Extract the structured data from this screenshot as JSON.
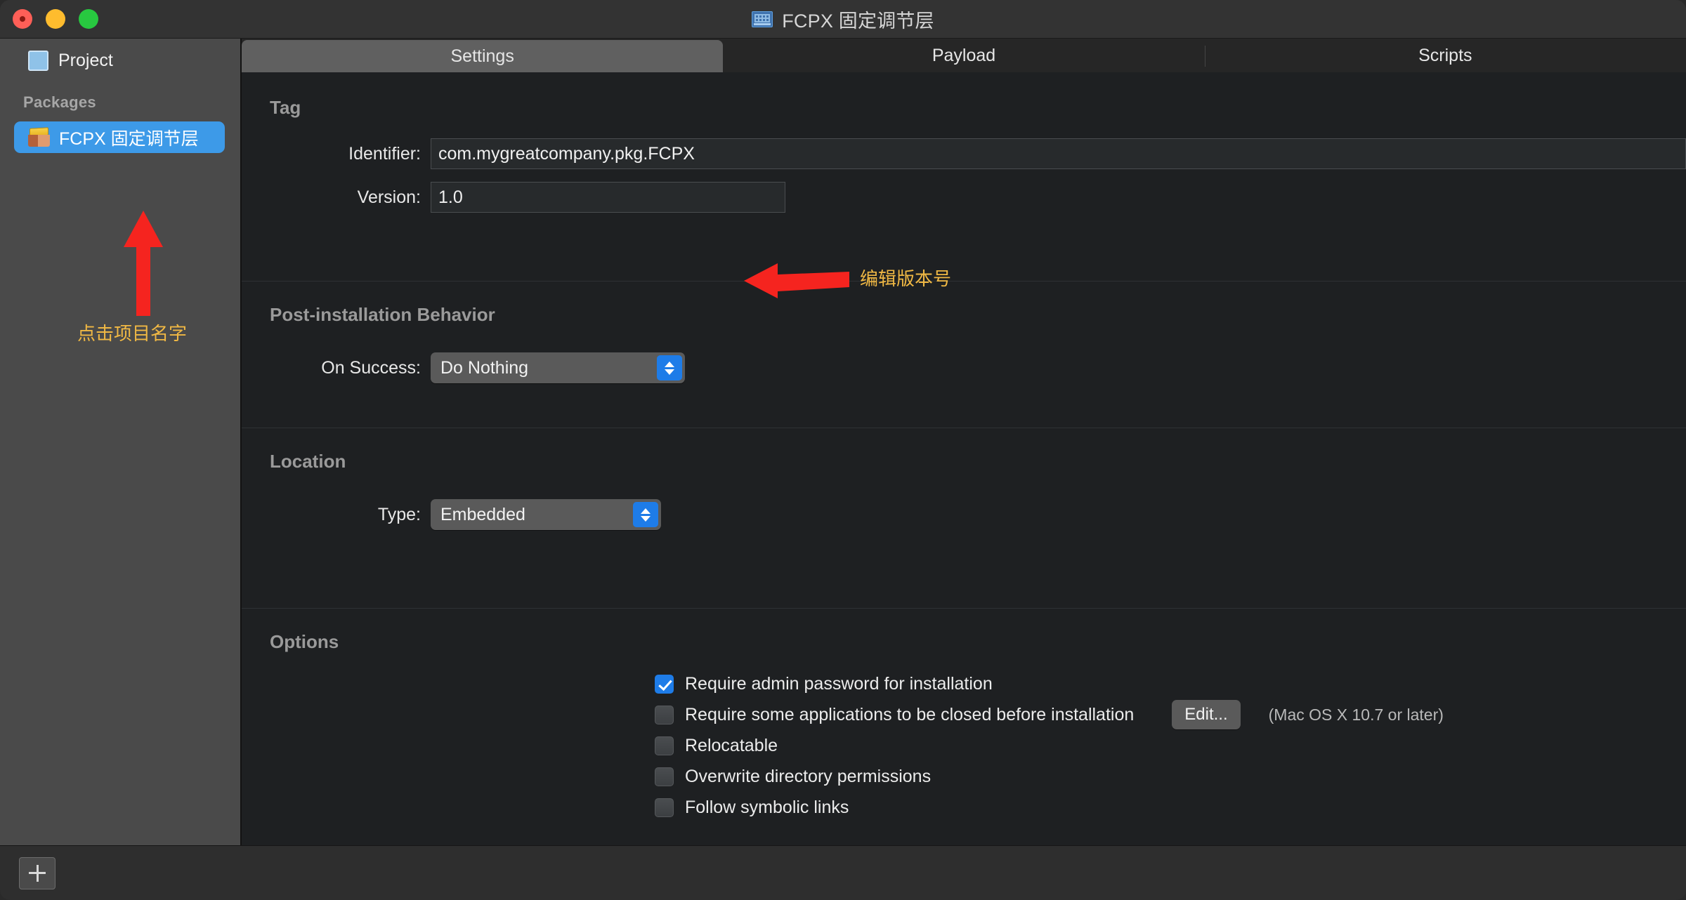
{
  "window": {
    "title": "FCPX 固定调节层",
    "title_icon": "package-window-icon",
    "traffic_lights": {
      "close": "close",
      "minimize": "minimize",
      "maximize": "maximize"
    }
  },
  "sidebar": {
    "project": {
      "label": "Project",
      "icon": "project-square-icon"
    },
    "section_header": "Packages",
    "packages": [
      {
        "label": "FCPX 固定调节层",
        "icon": "package-box-icon",
        "selected": true
      }
    ],
    "annotation": {
      "arrow": "red-up-arrow",
      "text": "点击项目名字",
      "color": "#f0b844"
    },
    "add_button": "+"
  },
  "tabs": [
    {
      "label": "Settings",
      "active": true
    },
    {
      "label": "Payload",
      "active": false
    },
    {
      "label": "Scripts",
      "active": false
    }
  ],
  "settings": {
    "tag": {
      "title": "Tag",
      "identifier": {
        "label": "Identifier:",
        "value": "com.mygreatcompany.pkg.FCPX"
      },
      "version": {
        "label": "Version:",
        "value": "1.0"
      },
      "annotation": {
        "arrow": "red-left-arrow",
        "text": "编辑版本号",
        "color": "#f0b844"
      }
    },
    "post_install": {
      "title": "Post-installation Behavior",
      "on_success": {
        "label": "On Success:",
        "value": "Do Nothing"
      }
    },
    "location": {
      "title": "Location",
      "type": {
        "label": "Type:",
        "value": "Embedded"
      }
    },
    "options": {
      "title": "Options",
      "items": [
        {
          "label": "Require admin password for installation",
          "checked": true
        },
        {
          "label": "Require some applications to be closed before installation",
          "checked": false,
          "button": "Edit...",
          "note": "(Mac OS X 10.7 or later)"
        },
        {
          "label": "Relocatable",
          "checked": false
        },
        {
          "label": "Overwrite directory permissions",
          "checked": false
        },
        {
          "label": "Follow symbolic links",
          "checked": false
        }
      ]
    }
  },
  "colors": {
    "accent_blue": "#1e7ce8",
    "selection_blue": "#3d9ae8",
    "annotation_gold": "#f0b844",
    "annotation_red": "#f5241f"
  }
}
